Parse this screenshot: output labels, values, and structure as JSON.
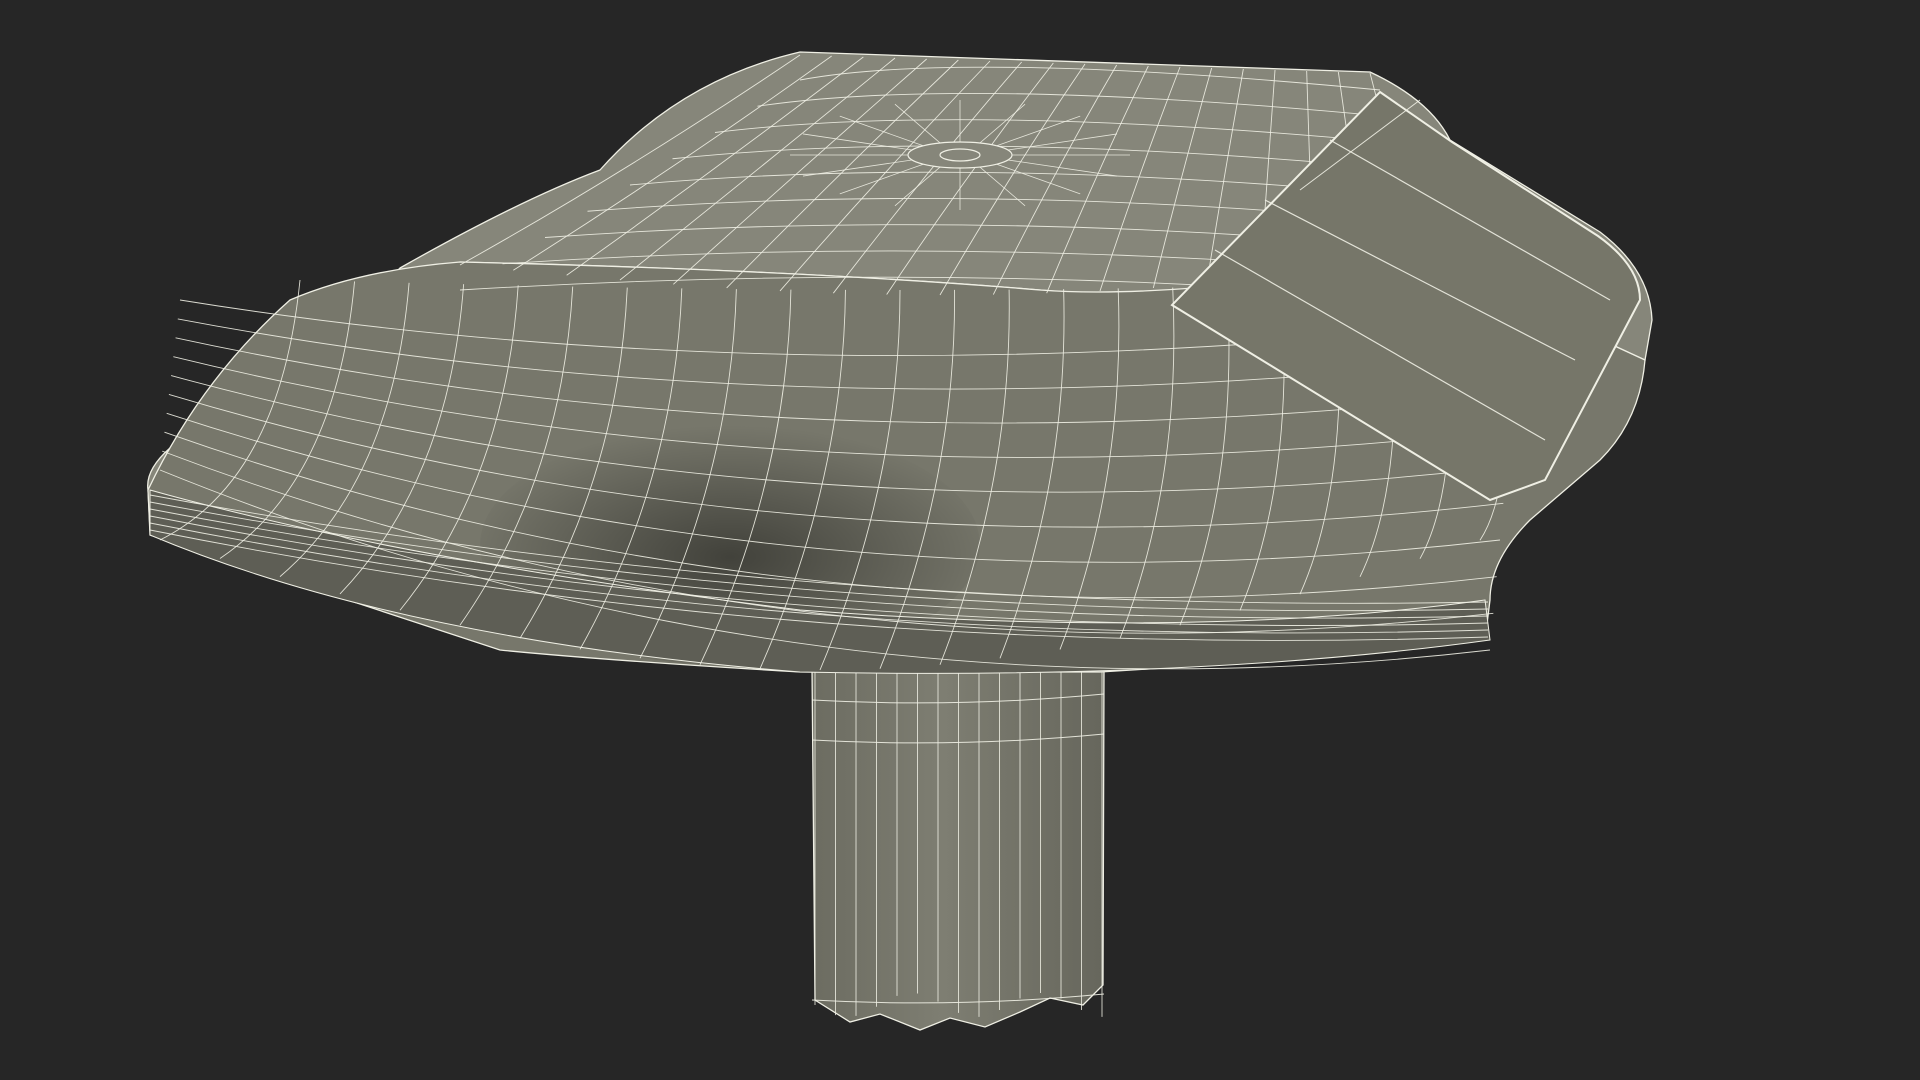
{
  "viewport": {
    "display_mode": "wireframe-on-shaded",
    "background_color": "#262626",
    "surface_color": "#77776B",
    "surface_shadow_color": "#5E5E55",
    "surface_highlight_color": "#86867A",
    "panel_color": "#767669",
    "wire_color": "#EFEFE4"
  },
  "model": {
    "object_name": "road-stud-solar-light",
    "parts": [
      "dome-body",
      "solar-panel",
      "top-nub",
      "anchor-stem"
    ]
  }
}
